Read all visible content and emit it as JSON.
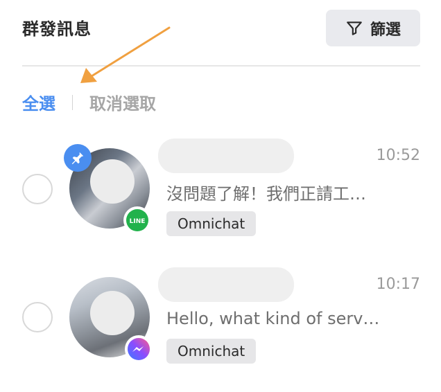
{
  "header": {
    "title": "群發訊息",
    "filter_label": "篩選"
  },
  "selection": {
    "select_all": "全選",
    "deselect": "取消選取"
  },
  "colors": {
    "accent": "#4a8ef0",
    "arrow": "#f0a040",
    "line": "#22b24c",
    "messenger": "#7b5cff"
  },
  "conversations": [
    {
      "time": "10:52",
      "message": "沒問題了解！我們正請工…",
      "tag": "Omnichat",
      "channel": "line-icon",
      "pinned": true,
      "channel_label": "LINE"
    },
    {
      "time": "10:17",
      "message": "Hello, what kind of serv…",
      "tag": "Omnichat",
      "channel": "messenger-icon",
      "pinned": false
    }
  ]
}
